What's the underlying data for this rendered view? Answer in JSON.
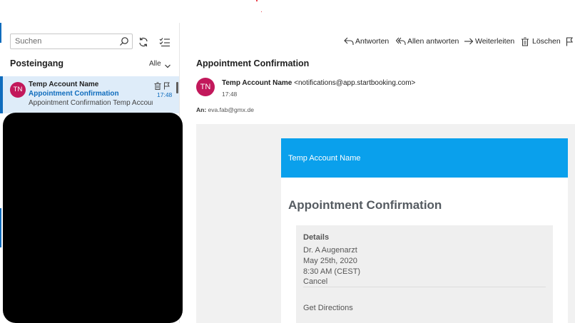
{
  "list": {
    "search_placeholder": "Suchen",
    "folder_title": "Posteingang",
    "filter_label": "Alle",
    "item": {
      "avatar_initials": "TN",
      "sender": "Temp Account Name",
      "subject": "Appointment Confirmation",
      "preview": "Appointment Confirmation Temp Account Name",
      "time": "17:48"
    }
  },
  "toolbar": {
    "reply": "Antworten",
    "reply_all": "Allen antworten",
    "forward": "Weiterleiten",
    "delete": "Löschen"
  },
  "message": {
    "subject": "Appointment Confirmation",
    "avatar_initials": "TN",
    "sender_name": "Temp Account Name",
    "sender_email": "<notifications@app.startbooking.com>",
    "time": "17:48",
    "to_label": "An:",
    "to_address": "eva.fab@gmx.de"
  },
  "email_body": {
    "brand": "Temp Account Name",
    "title": "Appointment Confirmation",
    "details_heading": "Details",
    "provider": "Dr. A Augenarzt",
    "date": "May 25th, 2020",
    "time": "8:30 AM (CEST)",
    "cancel_link": "Cancel",
    "directions_link": "Get Directions"
  },
  "colors": {
    "accent": "#0f6cbd",
    "avatar": "#c2185b",
    "email_header": "#0aa0ec",
    "selected_item": "#deecf9"
  }
}
